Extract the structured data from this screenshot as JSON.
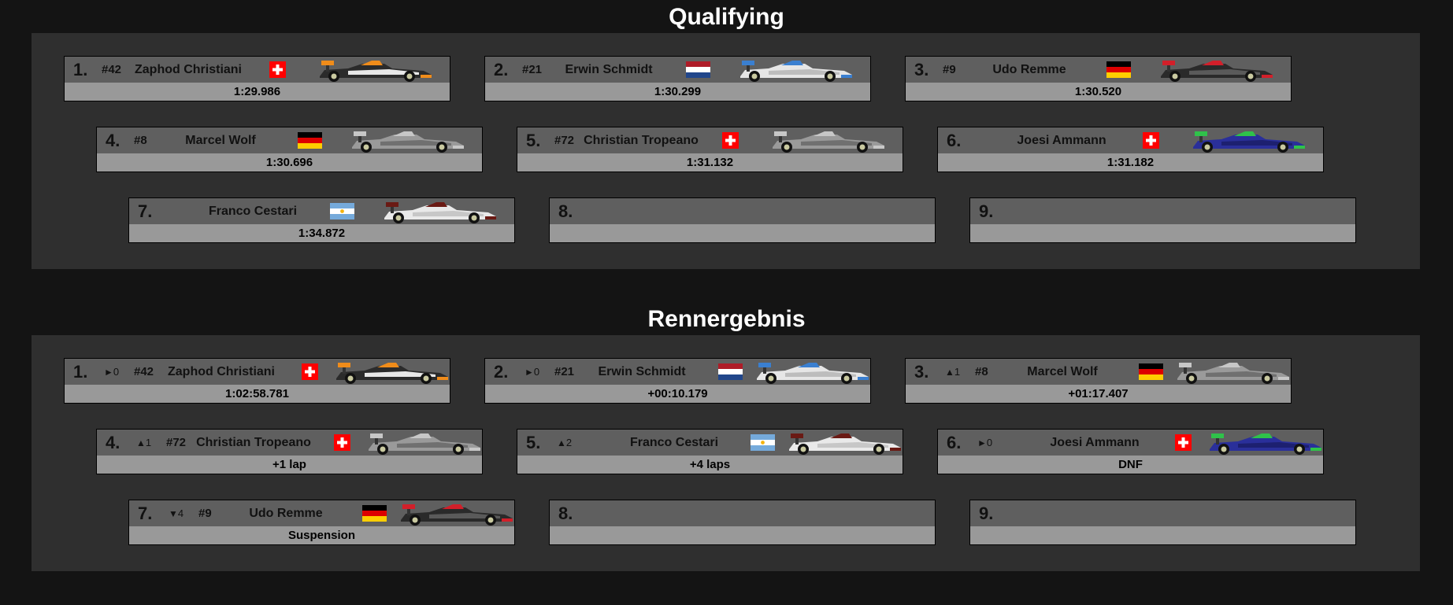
{
  "qualifying": {
    "title": "Qualifying",
    "entries": [
      {
        "pos": "1.",
        "number": "#42",
        "driver": "Zaphod Christiani",
        "flag": "switzerland",
        "car": "car-orange-white",
        "result": "1:29.986"
      },
      {
        "pos": "2.",
        "number": "#21",
        "driver": "Erwin Schmidt",
        "flag": "netherlands",
        "car": "car-blue-white",
        "result": "1:30.299"
      },
      {
        "pos": "3.",
        "number": "#9",
        "driver": "Udo Remme",
        "flag": "germany",
        "car": "car-red-black",
        "result": "1:30.520"
      },
      {
        "pos": "4.",
        "number": "#8",
        "driver": "Marcel Wolf",
        "flag": "germany",
        "car": "car-grey-silver",
        "result": "1:30.696"
      },
      {
        "pos": "5.",
        "number": "#72",
        "driver": "Christian Tropeano",
        "flag": "switzerland",
        "car": "car-grey-silver",
        "result": "1:31.132"
      },
      {
        "pos": "6.",
        "number": "",
        "driver": "Joesi Ammann",
        "flag": "switzerland",
        "car": "car-blue-green",
        "result": "1:31.182"
      },
      {
        "pos": "7.",
        "number": "",
        "driver": "Franco Cestari",
        "flag": "argentina",
        "car": "car-white-maroon",
        "result": "1:34.872"
      },
      {
        "pos": "8.",
        "number": "",
        "driver": "",
        "flag": "",
        "car": "",
        "result": ""
      },
      {
        "pos": "9.",
        "number": "",
        "driver": "",
        "flag": "",
        "car": "",
        "result": ""
      }
    ]
  },
  "race": {
    "title": "Rennergebnis",
    "entries": [
      {
        "pos": "1.",
        "change_symbol": "►",
        "change_value": "0",
        "number": "#42",
        "driver": "Zaphod Christiani",
        "flag": "switzerland",
        "car": "car-orange-white",
        "result": "1:02:58.781"
      },
      {
        "pos": "2.",
        "change_symbol": "►",
        "change_value": "0",
        "number": "#21",
        "driver": "Erwin Schmidt",
        "flag": "netherlands",
        "car": "car-blue-white",
        "result": "+00:10.179"
      },
      {
        "pos": "3.",
        "change_symbol": "▲",
        "change_value": "1",
        "number": "#8",
        "driver": "Marcel Wolf",
        "flag": "germany",
        "car": "car-grey-silver",
        "result": "+01:17.407"
      },
      {
        "pos": "4.",
        "change_symbol": "▲",
        "change_value": "1",
        "number": "#72",
        "driver": "Christian Tropeano",
        "flag": "switzerland",
        "car": "car-grey-silver",
        "result": "+1 lap"
      },
      {
        "pos": "5.",
        "change_symbol": "▲",
        "change_value": "2",
        "number": "",
        "driver": "Franco Cestari",
        "flag": "argentina",
        "car": "car-white-maroon",
        "result": "+4 laps"
      },
      {
        "pos": "6.",
        "change_symbol": "►",
        "change_value": "0",
        "number": "",
        "driver": "Joesi Ammann",
        "flag": "switzerland",
        "car": "car-blue-green",
        "result": "DNF"
      },
      {
        "pos": "7.",
        "change_symbol": "▼",
        "change_value": "4",
        "number": "#9",
        "driver": "Udo Remme",
        "flag": "germany",
        "car": "car-red-black",
        "result": "Suspension"
      },
      {
        "pos": "8.",
        "change_symbol": "",
        "change_value": "",
        "number": "",
        "driver": "",
        "flag": "",
        "car": "",
        "result": ""
      },
      {
        "pos": "9.",
        "change_symbol": "",
        "change_value": "",
        "number": "",
        "driver": "",
        "flag": "",
        "car": "",
        "result": ""
      }
    ]
  },
  "colors": {
    "page_bg": "#141414",
    "panel_bg": "#2f2f2f",
    "card_header": "#5f5f5f",
    "card_footer": "#999999"
  }
}
